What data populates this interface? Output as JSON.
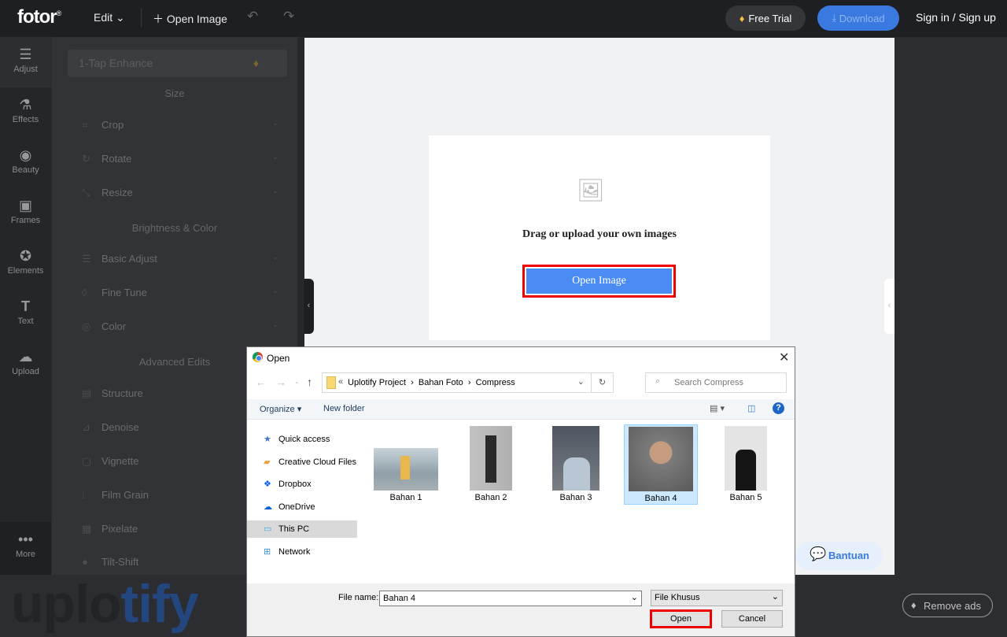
{
  "topbar": {
    "logo": "fotor",
    "edit": "Edit",
    "open_image": "Open Image",
    "free_trial": "Free Trial",
    "download": "Download",
    "sign": "Sign in / Sign up"
  },
  "rail": [
    {
      "label": "Adjust",
      "icon": "sliders-icon"
    },
    {
      "label": "Effects",
      "icon": "flask-icon"
    },
    {
      "label": "Beauty",
      "icon": "eye-icon"
    },
    {
      "label": "Frames",
      "icon": "frame-icon"
    },
    {
      "label": "Elements",
      "icon": "star-icon"
    },
    {
      "label": "Text",
      "icon": "text-icon"
    },
    {
      "label": "Upload",
      "icon": "cloud-upload-icon"
    },
    {
      "label": "More",
      "icon": "more-icon"
    }
  ],
  "panel": {
    "enhance": "1-Tap Enhance",
    "sections": [
      "Size",
      "Brightness & Color",
      "Advanced Edits"
    ],
    "items": [
      "Crop",
      "Rotate",
      "Resize",
      "Basic Adjust",
      "Fine Tune",
      "Color",
      "Structure",
      "Denoise",
      "Vignette",
      "Film Grain",
      "Pixelate",
      "Tilt-Shift"
    ]
  },
  "canvas": {
    "drag_text": "Drag or upload your own images",
    "open_button": "Open Image",
    "bantuan": "Bantuan",
    "remove_ads": "Remove ads"
  },
  "watermark": {
    "a": "uplo",
    "b": "tify"
  },
  "dialog": {
    "title": "Open",
    "path": [
      "Uplotify Project",
      "Bahan Foto",
      "Compress"
    ],
    "search_placeholder": "Search Compress",
    "organize": "Organize",
    "new_folder": "New folder",
    "nav": [
      "Quick access",
      "Creative Cloud Files",
      "Dropbox",
      "OneDrive",
      "This PC",
      "Network"
    ],
    "files": [
      "Bahan 1",
      "Bahan 2",
      "Bahan 3",
      "Bahan 4",
      "Bahan 5"
    ],
    "selected": "Bahan 4",
    "file_name_label": "File name:",
    "file_name": "Bahan 4",
    "file_type": "File Khusus",
    "open": "Open",
    "cancel": "Cancel"
  }
}
